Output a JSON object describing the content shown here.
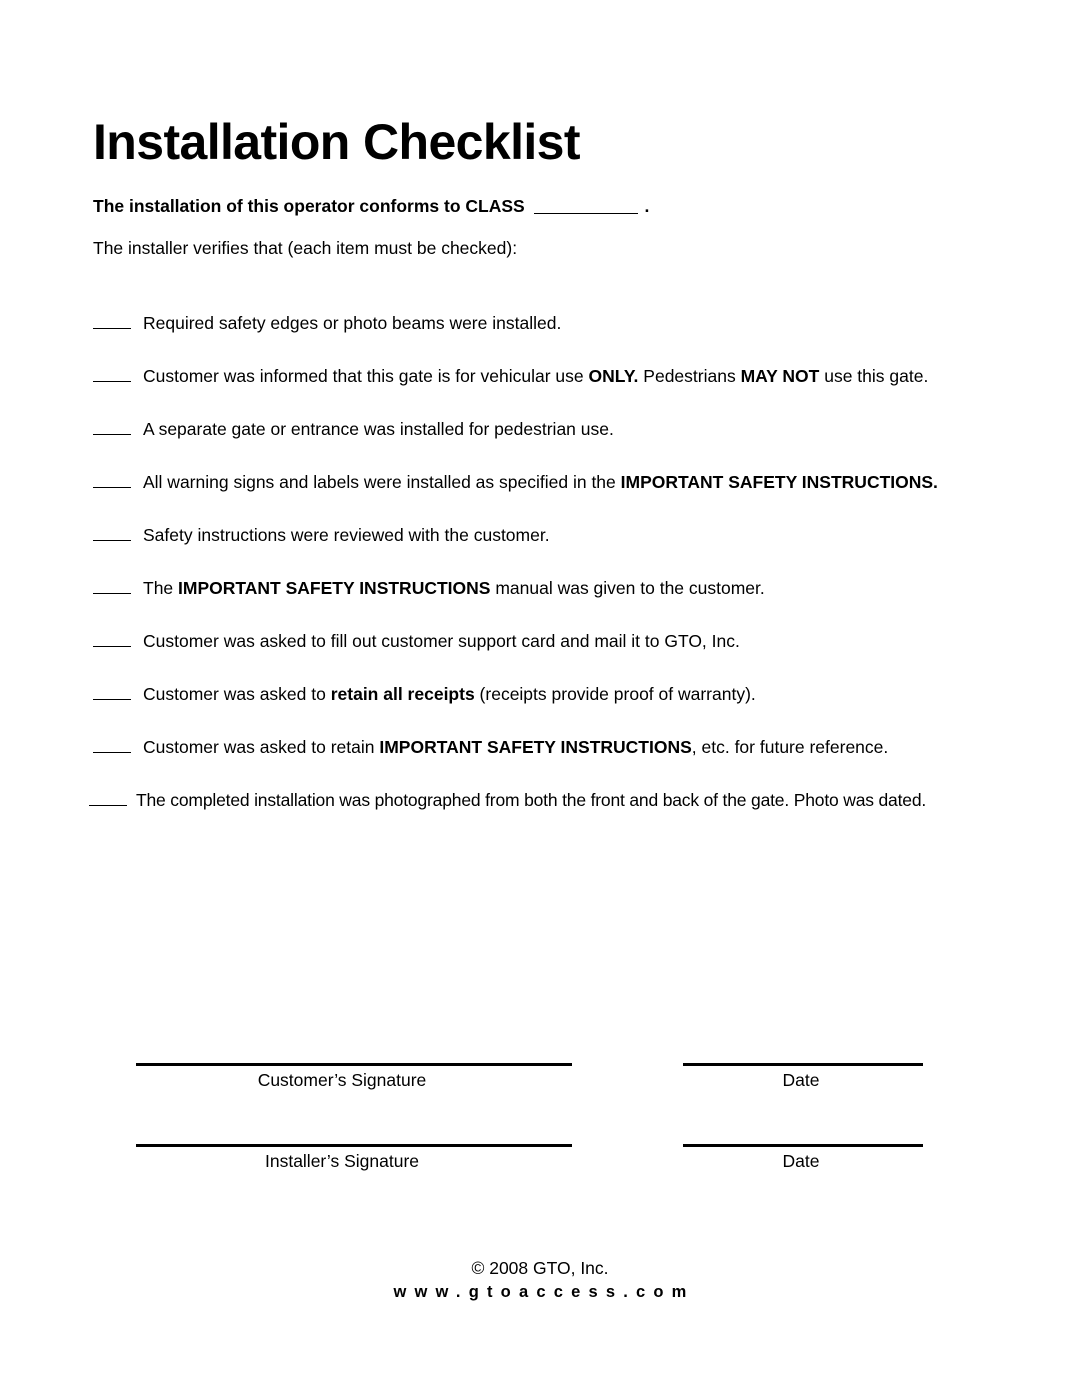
{
  "document": {
    "title": "Installation Checklist",
    "conformance": {
      "prefix": "The installation of this operator conforms to CLASS",
      "blank": "__________",
      "suffix": "."
    },
    "verifies_line": "The installer verifies that (each item must be checked):",
    "blank_mark": "____"
  },
  "checklist": {
    "items": [
      {
        "id": "safety-edges",
        "parts": [
          {
            "text": "Required safety edges or photo beams were installed.",
            "bold": false
          }
        ]
      },
      {
        "id": "vehicular-use-only",
        "parts": [
          {
            "text": "Customer was informed that this gate is for vehicular use ",
            "bold": false
          },
          {
            "text": "ONLY.",
            "bold": true
          },
          {
            "text": " Pedestrians ",
            "bold": false
          },
          {
            "text": "MAY NOT",
            "bold": true
          },
          {
            "text": " use this gate.",
            "bold": false
          }
        ]
      },
      {
        "id": "separate-pedestrian-gate",
        "parts": [
          {
            "text": "A separate gate or entrance was installed for pedestrian use.",
            "bold": false
          }
        ]
      },
      {
        "id": "warning-signs-labels",
        "parts": [
          {
            "text": "All warning signs and labels were installed as specified in the ",
            "bold": false
          },
          {
            "text": "IMPORTANT SAFETY INSTRUCTIONS.",
            "bold": true
          }
        ]
      },
      {
        "id": "safety-instructions-reviewed",
        "parts": [
          {
            "text": "Safety instructions were reviewed with the customer.",
            "bold": false
          }
        ]
      },
      {
        "id": "manual-given",
        "parts": [
          {
            "text": "The ",
            "bold": false
          },
          {
            "text": "IMPORTANT SAFETY INSTRUCTIONS",
            "bold": true
          },
          {
            "text": " manual was given to the customer.",
            "bold": false
          }
        ]
      },
      {
        "id": "support-card",
        "parts": [
          {
            "text": "Customer was asked to fill out customer support card and mail it to GTO, Inc.",
            "bold": false
          }
        ]
      },
      {
        "id": "retain-receipts",
        "parts": [
          {
            "text": "Customer was asked to ",
            "bold": false
          },
          {
            "text": "retain all receipts",
            "bold": true
          },
          {
            "text": " (receipts provide proof of warranty).",
            "bold": false
          }
        ]
      },
      {
        "id": "retain-instructions",
        "parts": [
          {
            "text": "Customer was asked to retain ",
            "bold": false
          },
          {
            "text": "IMPORTANT SAFETY INSTRUCTIONS",
            "bold": true
          },
          {
            "text": ", etc. for future reference.",
            "bold": false
          }
        ]
      },
      {
        "id": "photographed",
        "tight": true,
        "parts": [
          {
            "text": "The completed installation was photographed from both the front and back of the gate. Photo was dated.",
            "bold": false
          }
        ]
      }
    ]
  },
  "signatures": {
    "rows": [
      {
        "left_label": "Customer’s Signature",
        "right_label": "Date"
      },
      {
        "left_label": "Installer’s Signature",
        "right_label": "Date"
      }
    ]
  },
  "footer": {
    "copyright": "© 2008 GTO, Inc.",
    "website": "www.gtoaccess.com"
  }
}
